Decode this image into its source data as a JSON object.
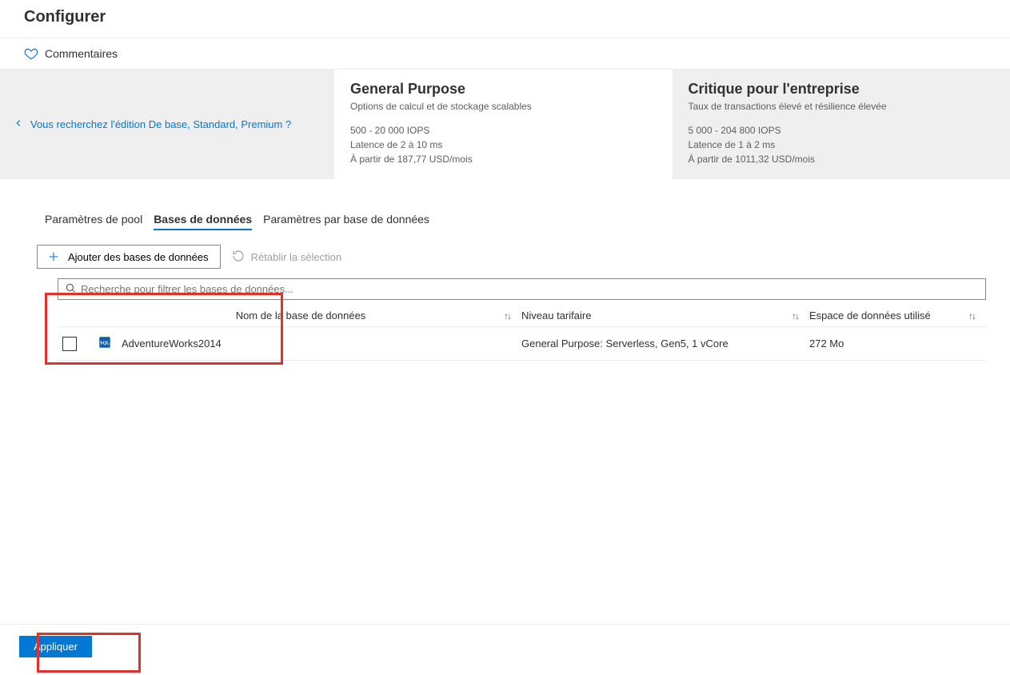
{
  "page": {
    "title": "Configurer"
  },
  "commands": {
    "feedback": "Commentaires"
  },
  "tier_link": "Vous recherchez l'édition De base, Standard, Premium ?",
  "tiers": [
    {
      "title": "General Purpose",
      "subtitle": "Options de calcul et de stockage scalables",
      "iops": "500 - 20 000 IOPS",
      "latency": "Latence de 2 à 10 ms",
      "price": "À partir de 187,77 USD/mois"
    },
    {
      "title": "Critique pour l'entreprise",
      "subtitle": "Taux de transactions élevé et résilience élevée",
      "iops": "5 000 - 204 800 IOPS",
      "latency": "Latence de 1 à 2 ms",
      "price": "À partir de 1011,32 USD/mois"
    }
  ],
  "tabs": {
    "pool": "Paramètres de pool",
    "databases": "Bases de données",
    "perdb": "Paramètres par base de données"
  },
  "toolbar": {
    "add": "Ajouter des bases de données",
    "reset": "Rétablir la sélection"
  },
  "search": {
    "placeholder": "Recherche pour filtrer les bases de données..."
  },
  "columns": {
    "name": "Nom de la base de données",
    "tier": "Niveau tarifaire",
    "space_used": "Espace de données utilisé"
  },
  "rows": [
    {
      "name": "AdventureWorks2014",
      "tier": "General Purpose: Serverless, Gen5, 1 vCore",
      "space_used": "272 Mo"
    }
  ],
  "footer": {
    "apply": "Appliquer"
  }
}
